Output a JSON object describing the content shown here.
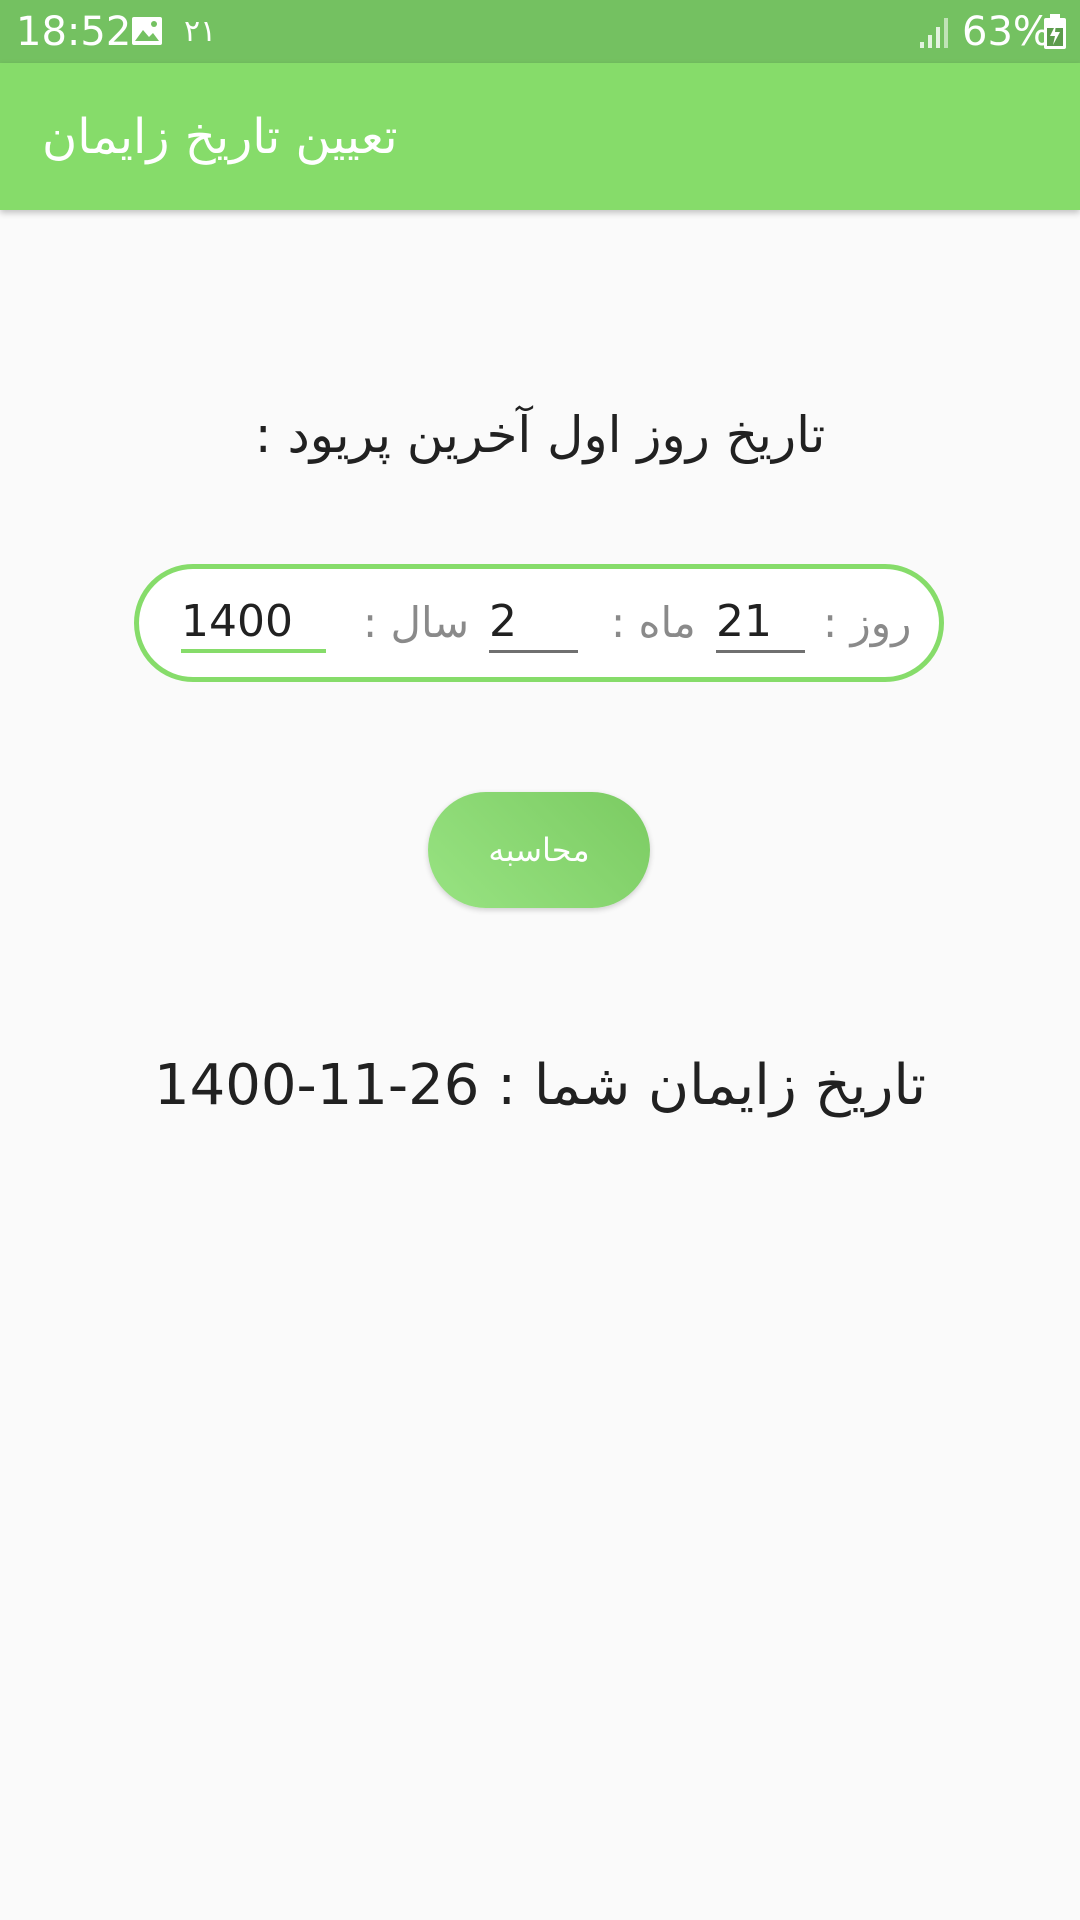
{
  "status_bar": {
    "time": "18:52",
    "notification_count": "۲۱",
    "battery_percent": "63%",
    "icons": [
      "gallery-icon",
      "signal-icon",
      "battery-icon"
    ]
  },
  "app_bar": {
    "title": "تعیین تاریخ زایمان"
  },
  "prompt": "تاریخ روز اول آخرین پریود :",
  "date_form": {
    "day_label": "روز :",
    "day_value": "21",
    "month_label": "ماه :",
    "month_value": "2",
    "year_label": "سال :",
    "year_value": "1400"
  },
  "calculate_button": "محاسبه",
  "result": {
    "label": "تاریخ زایمان شما :",
    "value": "1400-11-26"
  },
  "colors": {
    "status_bar": "#74c161",
    "app_bar": "#86dc6a",
    "accent": "#86dc6a",
    "background": "#fafafa",
    "text": "#212121"
  }
}
